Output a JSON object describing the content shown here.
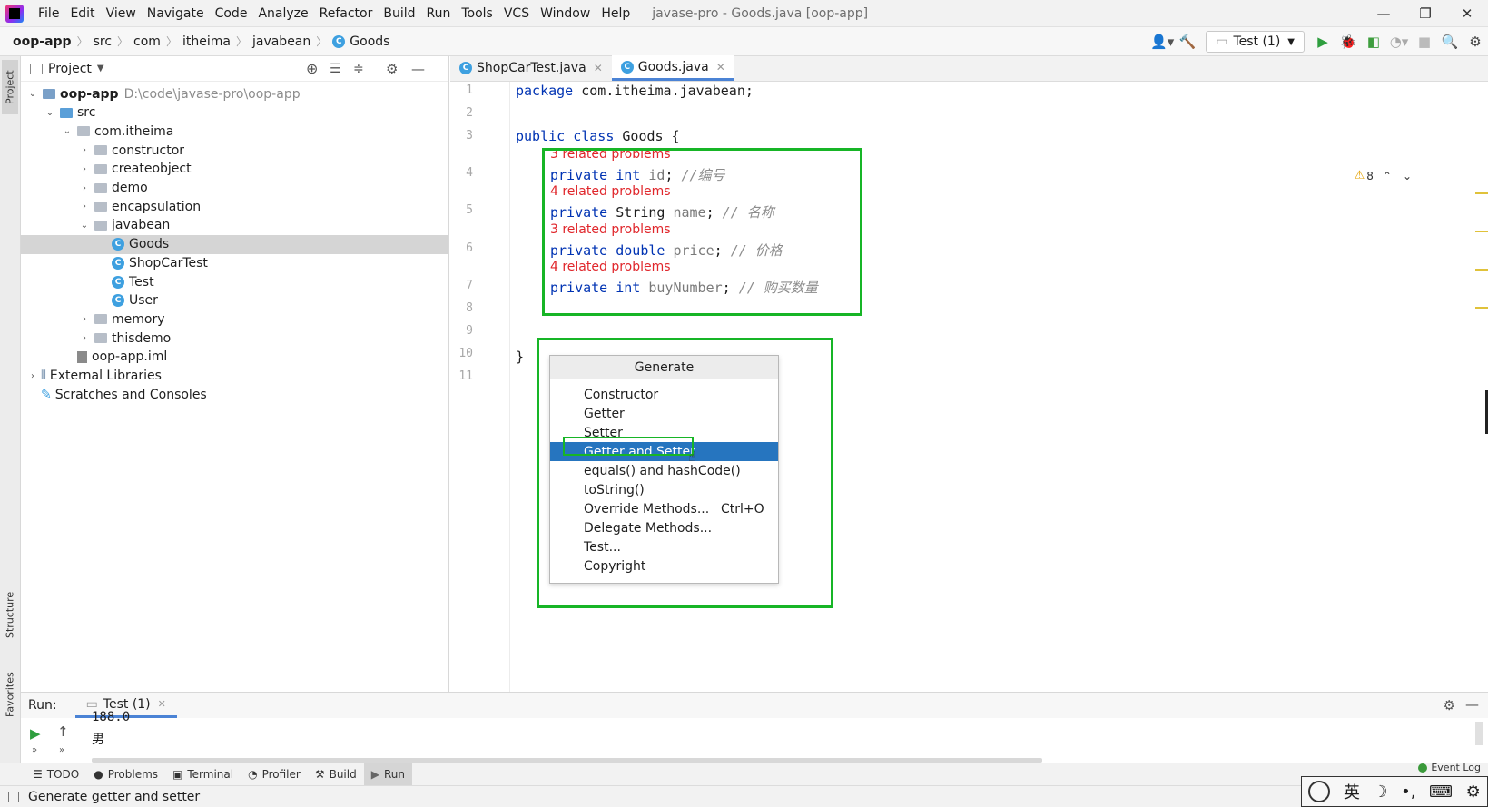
{
  "window": {
    "title": "javase-pro - Goods.java [oop-app]",
    "minimize": "—",
    "restore": "❐",
    "close": "✕"
  },
  "menu": [
    "File",
    "Edit",
    "View",
    "Navigate",
    "Code",
    "Analyze",
    "Refactor",
    "Build",
    "Run",
    "Tools",
    "VCS",
    "Window",
    "Help"
  ],
  "breadcrumb": [
    "oop-app",
    "src",
    "com",
    "itheima",
    "javabean",
    "Goods"
  ],
  "toolbar": {
    "run_config": "Test (1)"
  },
  "left_stripe": {
    "project": "Project",
    "structure": "Structure",
    "favorites": "Favorites"
  },
  "project_panel": {
    "title": "Project",
    "tree": [
      {
        "label": "oop-app",
        "hint": "D:\\code\\javase-pro\\oop-app",
        "depth": 0,
        "expanded": true,
        "kind": "module"
      },
      {
        "label": "src",
        "depth": 1,
        "expanded": true,
        "kind": "src"
      },
      {
        "label": "com.itheima",
        "depth": 2,
        "expanded": true,
        "kind": "package"
      },
      {
        "label": "constructor",
        "depth": 3,
        "expanded": false,
        "kind": "package"
      },
      {
        "label": "createobject",
        "depth": 3,
        "expanded": false,
        "kind": "package"
      },
      {
        "label": "demo",
        "depth": 3,
        "expanded": false,
        "kind": "package"
      },
      {
        "label": "encapsulation",
        "depth": 3,
        "expanded": false,
        "kind": "package"
      },
      {
        "label": "javabean",
        "depth": 3,
        "expanded": true,
        "kind": "package"
      },
      {
        "label": "Goods",
        "depth": 4,
        "kind": "class",
        "selected": true
      },
      {
        "label": "ShopCarTest",
        "depth": 4,
        "kind": "class"
      },
      {
        "label": "Test",
        "depth": 4,
        "kind": "class"
      },
      {
        "label": "User",
        "depth": 4,
        "kind": "class"
      },
      {
        "label": "memory",
        "depth": 3,
        "expanded": false,
        "kind": "package"
      },
      {
        "label": "thisdemo",
        "depth": 3,
        "expanded": false,
        "kind": "package"
      },
      {
        "label": "oop-app.iml",
        "depth": 2,
        "kind": "file"
      },
      {
        "label": "External Libraries",
        "depth": 0,
        "expanded": false,
        "kind": "lib"
      },
      {
        "label": "Scratches and Consoles",
        "depth": 0,
        "kind": "scratch"
      }
    ]
  },
  "editor": {
    "tabs": [
      {
        "label": "ShopCarTest.java",
        "active": false
      },
      {
        "label": "Goods.java",
        "active": true
      }
    ],
    "line_numbers": [
      "1",
      "2",
      "3",
      "4",
      "5",
      "6",
      "7",
      "8",
      "9",
      "10",
      "11"
    ],
    "lines": {
      "l1_kw": "package",
      "l1_rest": " com.itheima.javabean;",
      "l3_kw": "public class",
      "l3_rest": " Goods {",
      "l4_kw": "private int",
      "l4_field": " id",
      "l4_rest": "; ",
      "l4_comment": "//编号",
      "l5_kw": "private",
      "l5_type": " String",
      "l5_field": " name",
      "l5_rest": "; ",
      "l5_comment": "// 名称",
      "l6_kw": "private double",
      "l6_field": " price",
      "l6_rest": "; ",
      "l6_comment": "// 价格",
      "l7_kw": "private int",
      "l7_field": " buyNumber",
      "l7_rest": "; ",
      "l7_comment": "// 购买数量",
      "l10": "}"
    },
    "problems": [
      "3 related problems",
      "4 related problems",
      "3 related problems",
      "4 related problems"
    ],
    "warning_count": "8"
  },
  "generate_popup": {
    "title": "Generate",
    "items": [
      {
        "label": "Constructor"
      },
      {
        "label": "Getter"
      },
      {
        "label": "Setter"
      },
      {
        "label": "Getter and Setter",
        "selected": true
      },
      {
        "label": "equals() and hashCode()"
      },
      {
        "label": "toString()"
      },
      {
        "label": "Override Methods...",
        "shortcut": "Ctrl+O"
      },
      {
        "label": "Delegate Methods..."
      },
      {
        "label": "Test..."
      },
      {
        "label": "Copyright"
      }
    ]
  },
  "run_panel": {
    "label": "Run:",
    "tab": "Test (1)",
    "output": [
      "188.0",
      "男"
    ]
  },
  "tool_windows": [
    "TODO",
    "Problems",
    "Terminal",
    "Profiler",
    "Build",
    "Run"
  ],
  "tool_window_event_log": "Event Log",
  "status": {
    "message": "Generate getter and setter"
  },
  "ime": {
    "lang": "英",
    "moon": "☽",
    "punct": "•,",
    "keyboard": "⌨",
    "gear": "⚙"
  }
}
